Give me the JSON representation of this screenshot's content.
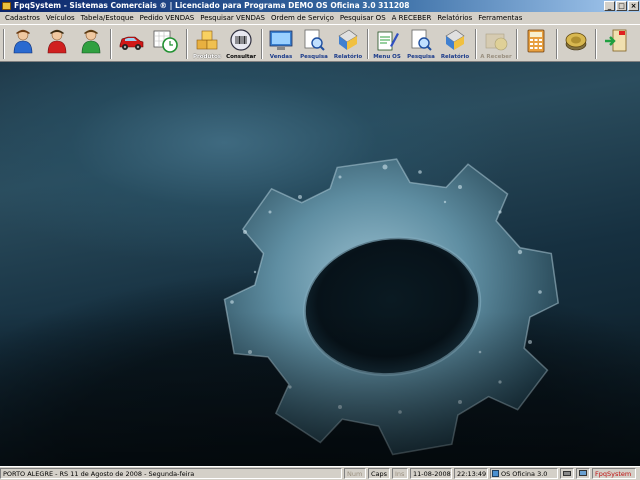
{
  "window": {
    "title": "FpqSystem - Sistemas Comerciais ® | Licenciado para Programa DEMO OS Oficina 3.0 311208",
    "buttons": [
      "minimize",
      "maximize",
      "close"
    ]
  },
  "menu": [
    "Cadastros",
    "Veículos",
    "Tabela/Estoque",
    "Pedido VENDAS",
    "Pesquisar VENDAS",
    "Ordem de Serviço",
    "Pesquisar OS",
    "A RECEBER",
    "Relatórios",
    "Ferramentas"
  ],
  "toolbar": {
    "clientes": "",
    "vendedores": "",
    "fornecedores": "",
    "veiculos": "",
    "agenda": "",
    "produtos": "Produtos",
    "consultar": "Consultar",
    "vendas": "Vendas",
    "pesquisa_vendas": "Pesquisa",
    "relatorio_vendas": "Relatório",
    "menu_os": "Menu OS",
    "pesquisa_os": "Pesquisa",
    "relatorio_os": "Relatório",
    "a_receber": "A Receber",
    "calculadora": "",
    "cofre": "",
    "sair": ""
  },
  "status": {
    "location": "PORTO ALEGRE - RS 11 de Agosto de 2008 - Segunda-feira",
    "num": "Num",
    "caps": "Caps",
    "ins": "Ins",
    "date": "11-08-2008",
    "time": "22:13:49",
    "version": "OS Oficina 3.0",
    "brand": "FpqSystem"
  },
  "colors": {
    "titlebar_start": "#0a246a",
    "titlebar_end": "#a6caf0",
    "chrome": "#d4d0c8",
    "toolbar_label": "#1a3a8a",
    "brand_red": "#c01010"
  }
}
